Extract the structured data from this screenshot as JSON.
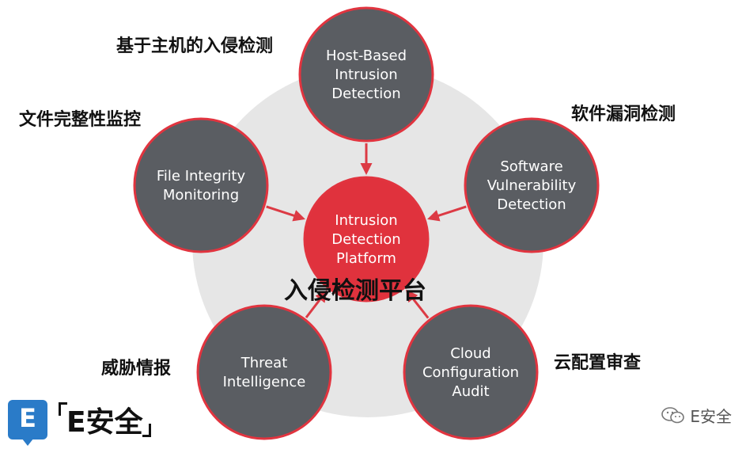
{
  "colors": {
    "background_disc": "#e6e6e6",
    "node_fill": "#5a5d62",
    "node_border": "#e1343f",
    "center_fill": "#e0323d",
    "arrow": "#dc3a44",
    "brand_blue": "#2a7bc8"
  },
  "center": {
    "lines": [
      "Intrusion",
      "Detection",
      "Platform"
    ],
    "cn_label": "入侵检测平台"
  },
  "nodes": [
    {
      "id": "host",
      "lines": [
        "Host-Based",
        "Intrusion",
        "Detection"
      ],
      "cn_label": "基于主机的入侵检测"
    },
    {
      "id": "software",
      "lines": [
        "Software",
        "Vulnerability",
        "Detection"
      ],
      "cn_label": "软件漏洞检测"
    },
    {
      "id": "cloud",
      "lines": [
        "Cloud",
        "Configuration",
        "Audit"
      ],
      "cn_label": "云配置审查"
    },
    {
      "id": "threat",
      "lines": [
        "Threat",
        "Intelligence"
      ],
      "cn_label": "威胁情报"
    },
    {
      "id": "file",
      "lines": [
        "File Integrity",
        "Monitoring"
      ],
      "cn_label": "文件完整性监控"
    }
  ],
  "branding": {
    "logo_letter": "E",
    "logo_text": "E安全",
    "watermark_text": "E安全",
    "watermark_icon": "wechat-icon"
  }
}
